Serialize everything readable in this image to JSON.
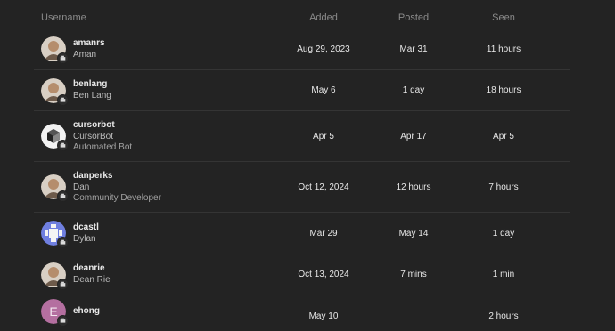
{
  "headers": {
    "username": "Username",
    "added": "Added",
    "posted": "Posted",
    "seen": "Seen"
  },
  "rows": [
    {
      "username": "amanrs",
      "name": "Aman",
      "title": "",
      "added": "Aug 29, 2023",
      "posted": "Mar 31",
      "seen": "11 hours",
      "avatar": "photo-portrait-icon"
    },
    {
      "username": "benlang",
      "name": "Ben Lang",
      "title": "",
      "added": "May 6",
      "posted": "1 day",
      "seen": "18 hours",
      "avatar": "photo-portrait-icon"
    },
    {
      "username": "cursorbot",
      "name": "CursorBot",
      "title": "Automated Bot",
      "added": "Apr 5",
      "posted": "Apr 17",
      "seen": "Apr 5",
      "avatar": "cube-logo-icon"
    },
    {
      "username": "danperks",
      "name": "Dan",
      "title": "Community Developer",
      "added": "Oct 12, 2024",
      "posted": "12 hours",
      "seen": "7 hours",
      "avatar": "photo-portrait-icon"
    },
    {
      "username": "dcastl",
      "name": "Dylan",
      "title": "",
      "added": "Mar 29",
      "posted": "May 14",
      "seen": "1 day",
      "avatar": "geometric-pattern-icon"
    },
    {
      "username": "deanrie",
      "name": "Dean Rie",
      "title": "",
      "added": "Oct 13, 2024",
      "posted": "7 mins",
      "seen": "1 min",
      "avatar": "photo-portrait-icon"
    },
    {
      "username": "ehong",
      "name": "",
      "title": "",
      "added": "May 10",
      "posted": "",
      "seen": "2 hours",
      "avatar": "letter-avatar-icon",
      "letter": "E"
    }
  ],
  "colors": {
    "background": "#232323",
    "divider": "#343434",
    "letter_avatar": "#b46fa0",
    "pattern_avatar": "#6f7fe0"
  }
}
